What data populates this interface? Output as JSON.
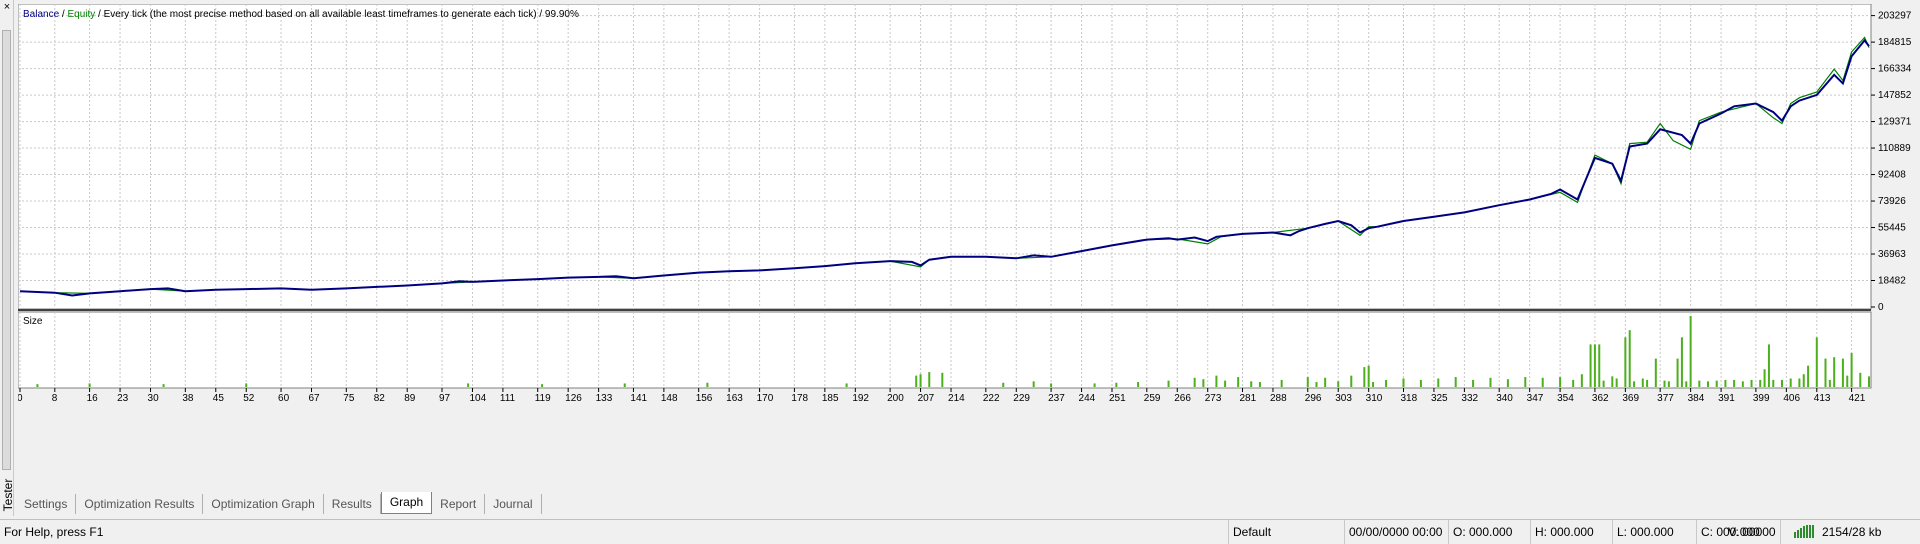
{
  "chart": {
    "title_balance": "Balance",
    "title_sep1": " / ",
    "title_equity": "Equity",
    "title_rest": " / Every tick (the most precise method based on all available least timeframes to generate each tick) / 99.90%",
    "size_label": "Size",
    "y_ticks": [
      "203297",
      "184815",
      "166334",
      "147852",
      "129371",
      "110889",
      "92408",
      "73926",
      "55445",
      "36963",
      "18482",
      "0"
    ],
    "x_ticks": [
      "0",
      "8",
      "16",
      "23",
      "30",
      "38",
      "45",
      "52",
      "60",
      "67",
      "75",
      "82",
      "89",
      "97",
      "104",
      "111",
      "119",
      "126",
      "133",
      "141",
      "148",
      "156",
      "163",
      "170",
      "178",
      "185",
      "192",
      "200",
      "207",
      "214",
      "222",
      "229",
      "237",
      "244",
      "251",
      "259",
      "266",
      "273",
      "281",
      "288",
      "296",
      "303",
      "310",
      "318",
      "325",
      "332",
      "340",
      "347",
      "354",
      "362",
      "369",
      "377",
      "384",
      "391",
      "399",
      "406",
      "413",
      "421"
    ],
    "colors": {
      "balance": "#000080",
      "equity": "#008000",
      "volume": "#4caf1c",
      "grid": "#c8c8c8"
    }
  },
  "chart_data": {
    "type": "line",
    "title": "Balance / Equity / Every tick (the most precise method based on all available least timeframes to generate each tick) / 99.90%",
    "xlim": [
      0,
      425
    ],
    "ylim": [
      0,
      210000
    ],
    "series": [
      {
        "name": "Balance",
        "x": [
          0,
          8,
          12,
          16,
          23,
          30,
          34,
          38,
          45,
          52,
          60,
          67,
          75,
          82,
          89,
          97,
          101,
          104,
          111,
          119,
          126,
          133,
          137,
          141,
          148,
          156,
          163,
          170,
          178,
          185,
          192,
          200,
          205,
          207,
          209,
          214,
          222,
          229,
          233,
          237,
          244,
          251,
          259,
          264,
          266,
          270,
          273,
          275,
          281,
          288,
          292,
          294,
          296,
          300,
          303,
          306,
          308,
          310,
          312,
          318,
          325,
          332,
          340,
          347,
          352,
          354,
          358,
          362,
          366,
          368,
          370,
          374,
          377,
          382,
          384,
          386,
          391,
          394,
          399,
          403,
          405,
          407,
          409,
          413,
          417,
          419,
          421,
          424,
          425
        ],
        "y": [
          11000,
          10000,
          8000,
          9500,
          11000,
          12500,
          13000,
          11000,
          12000,
          12500,
          13000,
          12000,
          13000,
          14000,
          15000,
          16500,
          18000,
          17500,
          18500,
          19500,
          20500,
          21000,
          21500,
          20000,
          22000,
          24000,
          25000,
          25500,
          27000,
          28500,
          30500,
          32000,
          31500,
          29000,
          33000,
          35000,
          35000,
          34000,
          36000,
          35000,
          39000,
          43000,
          47000,
          48000,
          47000,
          48500,
          46000,
          49000,
          51000,
          52000,
          50000,
          53000,
          55000,
          58000,
          60000,
          57000,
          52000,
          55000,
          56000,
          60000,
          63000,
          66000,
          71000,
          75000,
          79000,
          82000,
          75000,
          104000,
          100000,
          88000,
          112000,
          114000,
          124000,
          120000,
          114000,
          128000,
          135000,
          140000,
          142000,
          136000,
          130000,
          140000,
          144000,
          148000,
          162000,
          156000,
          175000,
          186000,
          182000
        ]
      },
      {
        "name": "Equity",
        "x": [
          0,
          8,
          16,
          23,
          30,
          38,
          45,
          52,
          60,
          67,
          75,
          82,
          89,
          97,
          104,
          111,
          119,
          126,
          133,
          141,
          148,
          156,
          163,
          170,
          178,
          185,
          192,
          200,
          207,
          209,
          214,
          222,
          229,
          237,
          244,
          251,
          259,
          266,
          273,
          276,
          281,
          288,
          296,
          303,
          308,
          310,
          312,
          318,
          325,
          332,
          340,
          347,
          354,
          358,
          362,
          366,
          368,
          370,
          374,
          377,
          380,
          384,
          386,
          391,
          399,
          403,
          405,
          407,
          409,
          413,
          417,
          419,
          421,
          424,
          425
        ],
        "y": [
          11000,
          10000,
          9500,
          11000,
          12500,
          11000,
          12000,
          12500,
          13000,
          12000,
          13000,
          14000,
          15000,
          16500,
          17500,
          18500,
          19500,
          20500,
          21000,
          20000,
          22000,
          24000,
          25000,
          25500,
          27000,
          28500,
          30500,
          32000,
          28000,
          33000,
          35000,
          35000,
          34000,
          35000,
          39000,
          43000,
          47000,
          47500,
          44000,
          49000,
          51000,
          52000,
          55000,
          60000,
          50000,
          56000,
          56000,
          60000,
          63000,
          66000,
          71000,
          75000,
          80000,
          73000,
          106000,
          100000,
          86000,
          114000,
          115000,
          128000,
          116000,
          110000,
          130000,
          136000,
          142000,
          132000,
          128000,
          142000,
          146000,
          150000,
          166000,
          158000,
          178000,
          188000,
          181000
        ]
      }
    ],
    "size_series": {
      "name": "Size",
      "x": [
        4,
        16,
        33,
        52,
        103,
        120,
        139,
        158,
        190,
        206,
        207,
        209,
        212,
        226,
        233,
        237,
        247,
        252,
        257,
        264,
        270,
        272,
        275,
        277,
        280,
        283,
        285,
        290,
        296,
        298,
        300,
        303,
        306,
        309,
        310,
        311,
        314,
        318,
        322,
        326,
        330,
        334,
        338,
        342,
        346,
        350,
        354,
        357,
        359,
        361,
        362,
        363,
        364,
        366,
        367,
        369,
        370,
        371,
        373,
        374,
        376,
        378,
        379,
        381,
        382,
        383,
        384,
        386,
        388,
        390,
        392,
        394,
        396,
        398,
        400,
        401,
        402,
        403,
        405,
        407,
        409,
        410,
        411,
        413,
        415,
        416,
        417,
        419,
        420,
        421,
        423,
        425
      ],
      "y": [
        0.04,
        0.05,
        0.04,
        0.05,
        0.05,
        0.04,
        0.05,
        0.06,
        0.05,
        0.16,
        0.18,
        0.21,
        0.2,
        0.06,
        0.08,
        0.05,
        0.05,
        0.06,
        0.07,
        0.09,
        0.13,
        0.11,
        0.16,
        0.09,
        0.14,
        0.08,
        0.07,
        0.1,
        0.14,
        0.07,
        0.13,
        0.08,
        0.16,
        0.28,
        0.3,
        0.07,
        0.1,
        0.12,
        0.1,
        0.12,
        0.14,
        0.1,
        0.13,
        0.11,
        0.14,
        0.13,
        0.14,
        0.1,
        0.18,
        0.6,
        0.6,
        0.6,
        0.09,
        0.15,
        0.12,
        0.7,
        0.8,
        0.08,
        0.12,
        0.1,
        0.4,
        0.09,
        0.08,
        0.4,
        0.7,
        0.08,
        1.0,
        0.09,
        0.08,
        0.09,
        0.1,
        0.1,
        0.08,
        0.1,
        0.1,
        0.25,
        0.6,
        0.1,
        0.1,
        0.12,
        0.12,
        0.18,
        0.3,
        0.7,
        0.4,
        0.1,
        0.42,
        0.4,
        0.16,
        0.48,
        0.2,
        0.15
      ]
    }
  },
  "tabs": [
    {
      "label": "Settings",
      "active": false
    },
    {
      "label": "Optimization Results",
      "active": false
    },
    {
      "label": "Optimization Graph",
      "active": false
    },
    {
      "label": "Results",
      "active": false
    },
    {
      "label": "Graph",
      "active": true
    },
    {
      "label": "Report",
      "active": false
    },
    {
      "label": "Journal",
      "active": false
    }
  ],
  "sidebar": {
    "tester_label": "Tester",
    "close_glyph": "×"
  },
  "statusbar": {
    "help": "For Help, press F1",
    "profile": "Default",
    "datetime": "00/00/0000 00:00",
    "open": "O: 000.000",
    "high": "H: 000.000",
    "low": "L: 000.000",
    "close": "C: 000.000",
    "volume": "V: 00000",
    "traffic": "2154/28 kb"
  }
}
